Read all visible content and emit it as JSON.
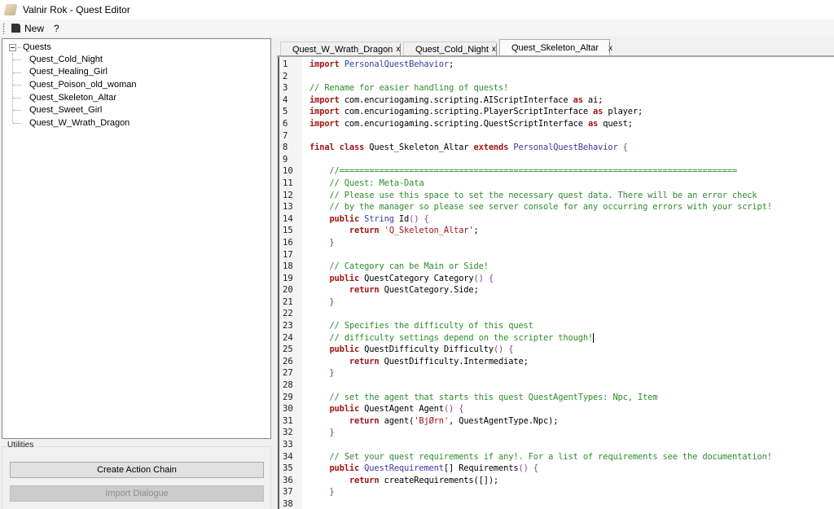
{
  "window": {
    "title": "Valnir Rok - Quest Editor"
  },
  "toolbar": {
    "new_label": "New",
    "help_label": "?"
  },
  "tree": {
    "root_label": "Quests",
    "items": [
      "Quest_Cold_Night",
      "Quest_Healing_Girl",
      "Quest_Poison_old_woman",
      "Quest_Skeleton_Altar",
      "Quest_Sweet_Girl",
      "Quest_W_Wrath_Dragon"
    ]
  },
  "utilities": {
    "label": "Utilities",
    "create_action_chain": "Create Action Chain",
    "import_dialogue": "Import Dialogue"
  },
  "tabs": [
    {
      "label": "Quest_W_Wrath_Dragon",
      "close": "x",
      "active": false
    },
    {
      "label": "Quest_Cold_Night",
      "close": "x",
      "active": false
    },
    {
      "label": "Quest_Skeleton_Altar",
      "close": "x",
      "active": true
    }
  ],
  "editor": {
    "lines": [
      [
        [
          "kw",
          "import"
        ],
        [
          "",
          ""
        ],
        [
          "ty",
          " PersonalQuestBehavior"
        ],
        [
          "",
          ";"
        ]
      ],
      [],
      [
        [
          "cm",
          "// Rename for easier handling of quests!"
        ]
      ],
      [
        [
          "kw",
          "import"
        ],
        [
          "",
          " com.encuriogaming.scripting.AIScriptInterface "
        ],
        [
          "kw",
          "as"
        ],
        [
          "",
          " ai;"
        ]
      ],
      [
        [
          "kw",
          "import"
        ],
        [
          "",
          " com.encuriogaming.scripting.PlayerScriptInterface "
        ],
        [
          "kw",
          "as"
        ],
        [
          "",
          " player;"
        ]
      ],
      [
        [
          "kw",
          "import"
        ],
        [
          "",
          " com.encuriogaming.scripting.QuestScriptInterface "
        ],
        [
          "kw",
          "as"
        ],
        [
          "",
          " quest;"
        ]
      ],
      [],
      [
        [
          "kw",
          "final class"
        ],
        [
          "",
          " Quest_Skeleton_Altar "
        ],
        [
          "kw",
          "extends"
        ],
        [
          "ty",
          " PersonalQuestBehavior"
        ],
        [
          "br",
          " {"
        ]
      ],
      [],
      [
        [
          "cm",
          "    //================================================================================"
        ]
      ],
      [
        [
          "cm",
          "    // Quest: Meta-Data"
        ]
      ],
      [
        [
          "cm",
          "    // Please use this space to set the necessary quest data. There will be an error check"
        ]
      ],
      [
        [
          "cm",
          "    // by the manager so please see server console for any occurring errors with your script!"
        ]
      ],
      [
        [
          "",
          "    "
        ],
        [
          "kw",
          "public"
        ],
        [
          "ty",
          " String"
        ],
        [
          "",
          " Id"
        ],
        [
          "br",
          "() {"
        ]
      ],
      [
        [
          "",
          "        "
        ],
        [
          "kw",
          "return"
        ],
        [
          "st",
          " 'Q_Skeleton_Altar'"
        ],
        [
          "",
          ";"
        ]
      ],
      [
        [
          "br",
          "    }"
        ]
      ],
      [],
      [
        [
          "cm",
          "    // Category can be Main or Side!"
        ]
      ],
      [
        [
          "",
          "    "
        ],
        [
          "kw",
          "public"
        ],
        [
          "",
          " QuestCategory Category"
        ],
        [
          "br",
          "() {"
        ]
      ],
      [
        [
          "",
          "        "
        ],
        [
          "kw",
          "return"
        ],
        [
          "",
          " QuestCategory.Side;"
        ]
      ],
      [
        [
          "br",
          "    }"
        ]
      ],
      [],
      [
        [
          "cm",
          "    // Specifies the difficulty of this quest"
        ]
      ],
      [
        [
          "cm",
          "    // difficulty settings depend on the scripter though!"
        ],
        [
          "caret",
          ""
        ]
      ],
      [
        [
          "",
          "    "
        ],
        [
          "kw",
          "public"
        ],
        [
          "",
          " QuestDifficulty Difficulty"
        ],
        [
          "br",
          "() {"
        ]
      ],
      [
        [
          "",
          "        "
        ],
        [
          "kw",
          "return"
        ],
        [
          "",
          " QuestDifficulty.Intermediate;"
        ]
      ],
      [
        [
          "br",
          "    }"
        ]
      ],
      [],
      [
        [
          "cm",
          "    // set the agent that starts this quest QuestAgentTypes: Npc, Item"
        ]
      ],
      [
        [
          "",
          "    "
        ],
        [
          "kw",
          "public"
        ],
        [
          "",
          " QuestAgent Agent"
        ],
        [
          "br",
          "() {"
        ]
      ],
      [
        [
          "",
          "        "
        ],
        [
          "kw",
          "return"
        ],
        [
          "",
          " agent("
        ],
        [
          "st",
          "'BjØrn'"
        ],
        [
          "",
          ", QuestAgentType.Npc);"
        ]
      ],
      [
        [
          "br",
          "    }"
        ]
      ],
      [],
      [
        [
          "cm",
          "    // Set your quest requirements if any!. For a list of requirements see the documentation!"
        ]
      ],
      [
        [
          "",
          "    "
        ],
        [
          "kw",
          "public"
        ],
        [
          "ty",
          " QuestRequirement"
        ],
        [
          "",
          "[] Requirements"
        ],
        [
          "br",
          "() {"
        ]
      ],
      [
        [
          "",
          "        "
        ],
        [
          "kw",
          "return"
        ],
        [
          "",
          " createRequirements([]);"
        ]
      ],
      [
        [
          "br",
          "    }"
        ]
      ],
      []
    ]
  }
}
